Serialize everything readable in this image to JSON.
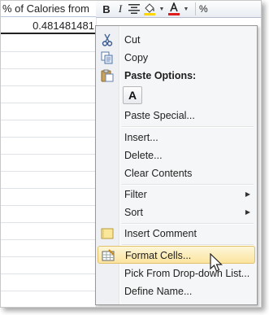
{
  "sheet": {
    "header_text": "% of Calories from",
    "cell_value": "0.481481481"
  },
  "toolbar": {
    "bold": "B",
    "italic": "I",
    "font_color_glyph": "A",
    "percent": "%"
  },
  "menu": {
    "cut": "Cut",
    "copy": "Copy",
    "paste_options": "Paste Options:",
    "paste_a": "A",
    "paste_special": "Paste Special...",
    "insert": "Insert...",
    "delete": "Delete...",
    "clear_contents": "Clear Contents",
    "filter": "Filter",
    "sort": "Sort",
    "insert_comment": "Insert Comment",
    "format_cells": "Format Cells...",
    "pick_from_list": "Pick From Drop-down List...",
    "define_name": "Define Name..."
  },
  "colors": {
    "highlight": "#fbe49f",
    "font_color_underline": "#e01b1b",
    "fill_color_underline": "#ffd700"
  },
  "icons": [
    "scissors-icon",
    "copy-icon",
    "clipboard-icon",
    "comment-icon",
    "format-cells-icon",
    "bucket-icon",
    "font-color-icon",
    "align-icon",
    "mouse-pointer-icon"
  ]
}
